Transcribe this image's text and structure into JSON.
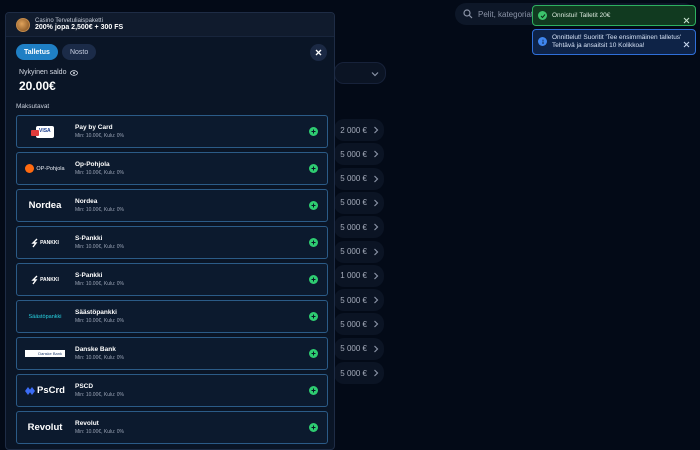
{
  "header": {
    "search_placeholder": "Pelit, kategoriat, peli"
  },
  "background_list": {
    "amounts": [
      "2 000 €",
      "5 000 €",
      "5 000 €",
      "5 000 €",
      "5 000 €",
      "5 000 €",
      "1 000 €",
      "5 000 €",
      "5 000 €",
      "5 000 €",
      "5 000 €"
    ]
  },
  "bonus": {
    "title": "Casino Tervetuliaispaketti",
    "offer": "200% jopa 2,500€ + 300 FS"
  },
  "tabs": [
    {
      "label": "Talletus",
      "active": true
    },
    {
      "label": "Nosto",
      "active": false
    }
  ],
  "balance": {
    "label": "Nykyinen saldo",
    "value": "20.00€"
  },
  "methods_heading": "Maksutavat",
  "methods": [
    {
      "name": "Pay by Card",
      "meta": "Min: 10.00€, Kulu: 0%",
      "logo": "card-icon",
      "logo_text": "VISA"
    },
    {
      "name": "Op-Pohjola",
      "meta": "Min: 10.00€, Kulu: 0%",
      "logo": "op-pohjola-logo",
      "logo_text": "OP-Pohjola"
    },
    {
      "name": "Nordea",
      "meta": "Min: 10.00€, Kulu: 0%",
      "logo": "nordea-logo",
      "logo_text": "Nordea"
    },
    {
      "name": "S-Pankki",
      "meta": "Min: 10.00€, Kulu: 0%",
      "logo": "s-pankki-logo",
      "logo_text": "PANKKI"
    },
    {
      "name": "S-Pankki",
      "meta": "Min: 10.00€, Kulu: 0%",
      "logo": "s-pankki-logo",
      "logo_text": "PANKKI"
    },
    {
      "name": "Säästöpankki",
      "meta": "Min: 10.00€, Kulu: 0%",
      "logo": "saastopankki-logo",
      "logo_text": "Säästöpankki"
    },
    {
      "name": "Danske Bank",
      "meta": "Min: 10.00€, Kulu: 0%",
      "logo": "danske-bank-logo",
      "logo_text": "Danske Bank"
    },
    {
      "name": "PSCD",
      "meta": "Min: 10.00€, Kulu: 0%",
      "logo": "pscrd-logo",
      "logo_text": "PsCrd"
    },
    {
      "name": "Revolut",
      "meta": "Min: 10.00€, Kulu: 0%",
      "logo": "revolut-logo",
      "logo_text": "Revolut"
    }
  ],
  "toasts": {
    "success": "Onnistui! Talletit 20€",
    "info": "Onnittelut! Suoritit 'Tee ensimmäinen talletus' Tehtävä ja ansaitsit 10 Kolikkoa!"
  },
  "colors": {
    "accent": "#1f7fc4",
    "add": "#2ecc71",
    "success_border": "#2eb060",
    "info_border": "#2f6fd9"
  }
}
